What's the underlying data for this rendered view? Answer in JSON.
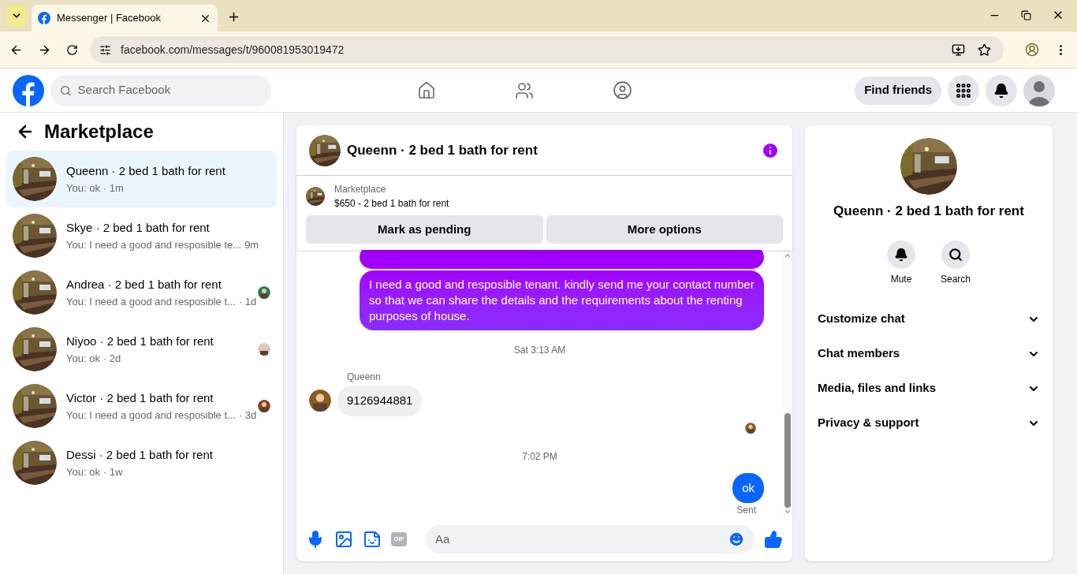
{
  "browser": {
    "tab_title": "Messenger | Facebook",
    "url": "facebook.com/messages/t/960081953019472"
  },
  "header": {
    "search_placeholder": "Search Facebook",
    "find_friends": "Find friends"
  },
  "sidebar": {
    "title": "Marketplace",
    "conversations": [
      {
        "name": "Queenn · 2 bed 1 bath for rent",
        "preview": "You: ok",
        "time": "· 1m",
        "selected": true,
        "seen": false
      },
      {
        "name": "Skye · 2 bed 1 bath for rent",
        "preview": "You: I need a good and resposible te...",
        "time": "9m",
        "selected": false,
        "seen": false
      },
      {
        "name": "Andrea · 2 bed 1 bath for rent",
        "preview": "You: I need a good and resposible t...",
        "time": "· 1d",
        "selected": false,
        "seen": true
      },
      {
        "name": "Niyoo · 2 bed 1 bath for rent",
        "preview": "You: ok",
        "time": "· 2d",
        "selected": false,
        "seen": true
      },
      {
        "name": "Victor · 2 bed 1 bath for rent",
        "preview": "You: I need a good and resposible t...",
        "time": "· 3d",
        "selected": false,
        "seen": true
      },
      {
        "name": "Dessi · 2 bed 1 bath for rent",
        "preview": "You: ok",
        "time": "· 1w",
        "selected": false,
        "seen": false
      }
    ]
  },
  "chat": {
    "title": "Queenn · 2 bed 1 bath for rent",
    "listing": {
      "source": "Marketplace",
      "title": "$650 - 2 bed 1 bath for rent"
    },
    "buttons": [
      "Mark as pending",
      "More options"
    ],
    "messages": [
      {
        "kind": "outgoing",
        "text": "I need a good and resposible tenant.  kindly send me your contact number so that we can share the details and the requirements about the renting purposes of house."
      },
      {
        "kind": "time",
        "text": "Sat 3:13 AM"
      },
      {
        "kind": "incoming",
        "sender": "Queenn",
        "text": "9126944881"
      },
      {
        "kind": "seen"
      },
      {
        "kind": "time",
        "text": "7:02 PM"
      },
      {
        "kind": "sent",
        "text": "ok",
        "status": "Sent"
      }
    ],
    "composer": {
      "gif": "GIF",
      "placeholder": "Aa"
    }
  },
  "details": {
    "name": "Queenn · 2 bed 1 bath for rent",
    "actions": [
      {
        "kind": "bell",
        "label": "Mute"
      },
      {
        "kind": "search",
        "label": "Search"
      }
    ],
    "sections": [
      {
        "label": "Customize chat",
        "expanded": false
      },
      {
        "label": "Chat members",
        "expanded": false
      },
      {
        "label": "Media, files and links",
        "expanded": false
      },
      {
        "label": "Privacy & support",
        "expanded": false
      }
    ]
  }
}
